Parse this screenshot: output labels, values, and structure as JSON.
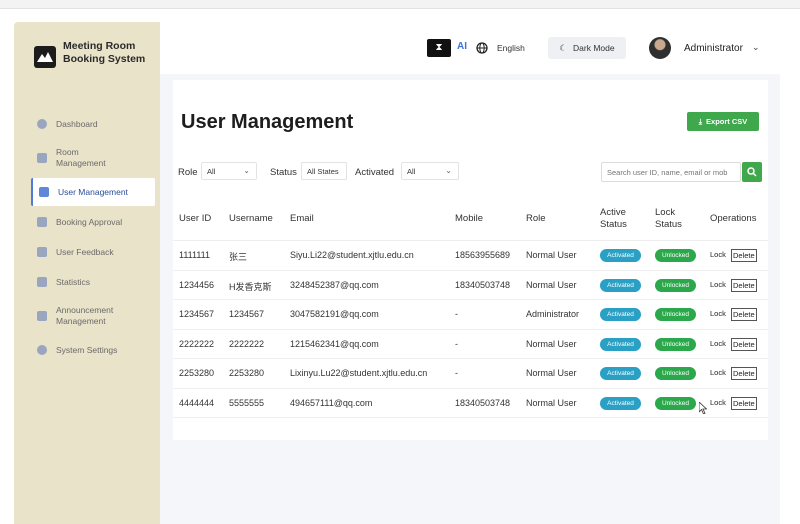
{
  "app": {
    "title": "Meeting Room Booking System"
  },
  "sidebar": {
    "items": [
      {
        "label": "Dashboard",
        "icon": "dashboard-icon"
      },
      {
        "label": "Room Management",
        "icon": "room-icon"
      },
      {
        "label": "User Management",
        "icon": "users-icon",
        "active": true
      },
      {
        "label": "Booking Approval",
        "icon": "approval-icon"
      },
      {
        "label": "User Feedback",
        "icon": "feedback-icon"
      },
      {
        "label": "Statistics",
        "icon": "statistics-icon"
      },
      {
        "label": "Announcement Management",
        "icon": "megaphone-icon"
      },
      {
        "label": "System Settings",
        "icon": "settings-icon"
      }
    ]
  },
  "header": {
    "ai_toggle_icon": "hourglass-icon",
    "ai_label": "AI",
    "language": "English",
    "dark_mode": "Dark Mode",
    "user": "Administrator"
  },
  "page": {
    "title": "User Management",
    "export_label": "Export CSV"
  },
  "filters": {
    "role_label": "Role",
    "role_value": "All",
    "status_label": "Status",
    "status_value": "All States",
    "activated_label": "Activated",
    "activated_value": "All",
    "search_placeholder": "Search user ID, name, email or mob"
  },
  "table": {
    "headers": {
      "user_id": "User ID",
      "username": "Username",
      "email": "Email",
      "mobile": "Mobile",
      "role": "Role",
      "active_status": "Active Status",
      "lock_status": "Lock Status",
      "operations": "Operations"
    },
    "lock_label": "Lock",
    "delete_label": "Delete",
    "rows": [
      {
        "id": "1111111",
        "username": "张三",
        "email": "Siyu.Li22@student.xjtlu.edu.cn",
        "mobile": "18563955689",
        "role": "Normal User",
        "active": "Activated",
        "lock": "Unlocked"
      },
      {
        "id": "1234456",
        "username": "H发香克斯",
        "email": "3248452387@qq.com",
        "mobile": "18340503748",
        "role": "Normal User",
        "active": "Activated",
        "lock": "Unlocked"
      },
      {
        "id": "1234567",
        "username": "1234567",
        "email": "3047582191@qq.com",
        "mobile": "-",
        "role": "Administrator",
        "active": "Activated",
        "lock": "Unlocked"
      },
      {
        "id": "2222222",
        "username": "2222222",
        "email": "1215462341@qq.com",
        "mobile": "-",
        "role": "Normal User",
        "active": "Activated",
        "lock": "Unlocked"
      },
      {
        "id": "2253280",
        "username": "2253280",
        "email": "Lixinyu.Lu22@student.xjtlu.edu.cn",
        "mobile": "-",
        "role": "Normal User",
        "active": "Activated",
        "lock": "Unlocked"
      },
      {
        "id": "4444444",
        "username": "5555555",
        "email": "494657111@qq.com",
        "mobile": "18340503748",
        "role": "Normal User",
        "active": "Activated",
        "lock": "Unlocked"
      }
    ]
  },
  "colors": {
    "sidebar_bg": "#e9e3c9",
    "accent": "#4e7bd8",
    "export_green": "#3fa84c",
    "activated_badge": "#2aa0c4",
    "unlocked_badge": "#2ba84b"
  }
}
